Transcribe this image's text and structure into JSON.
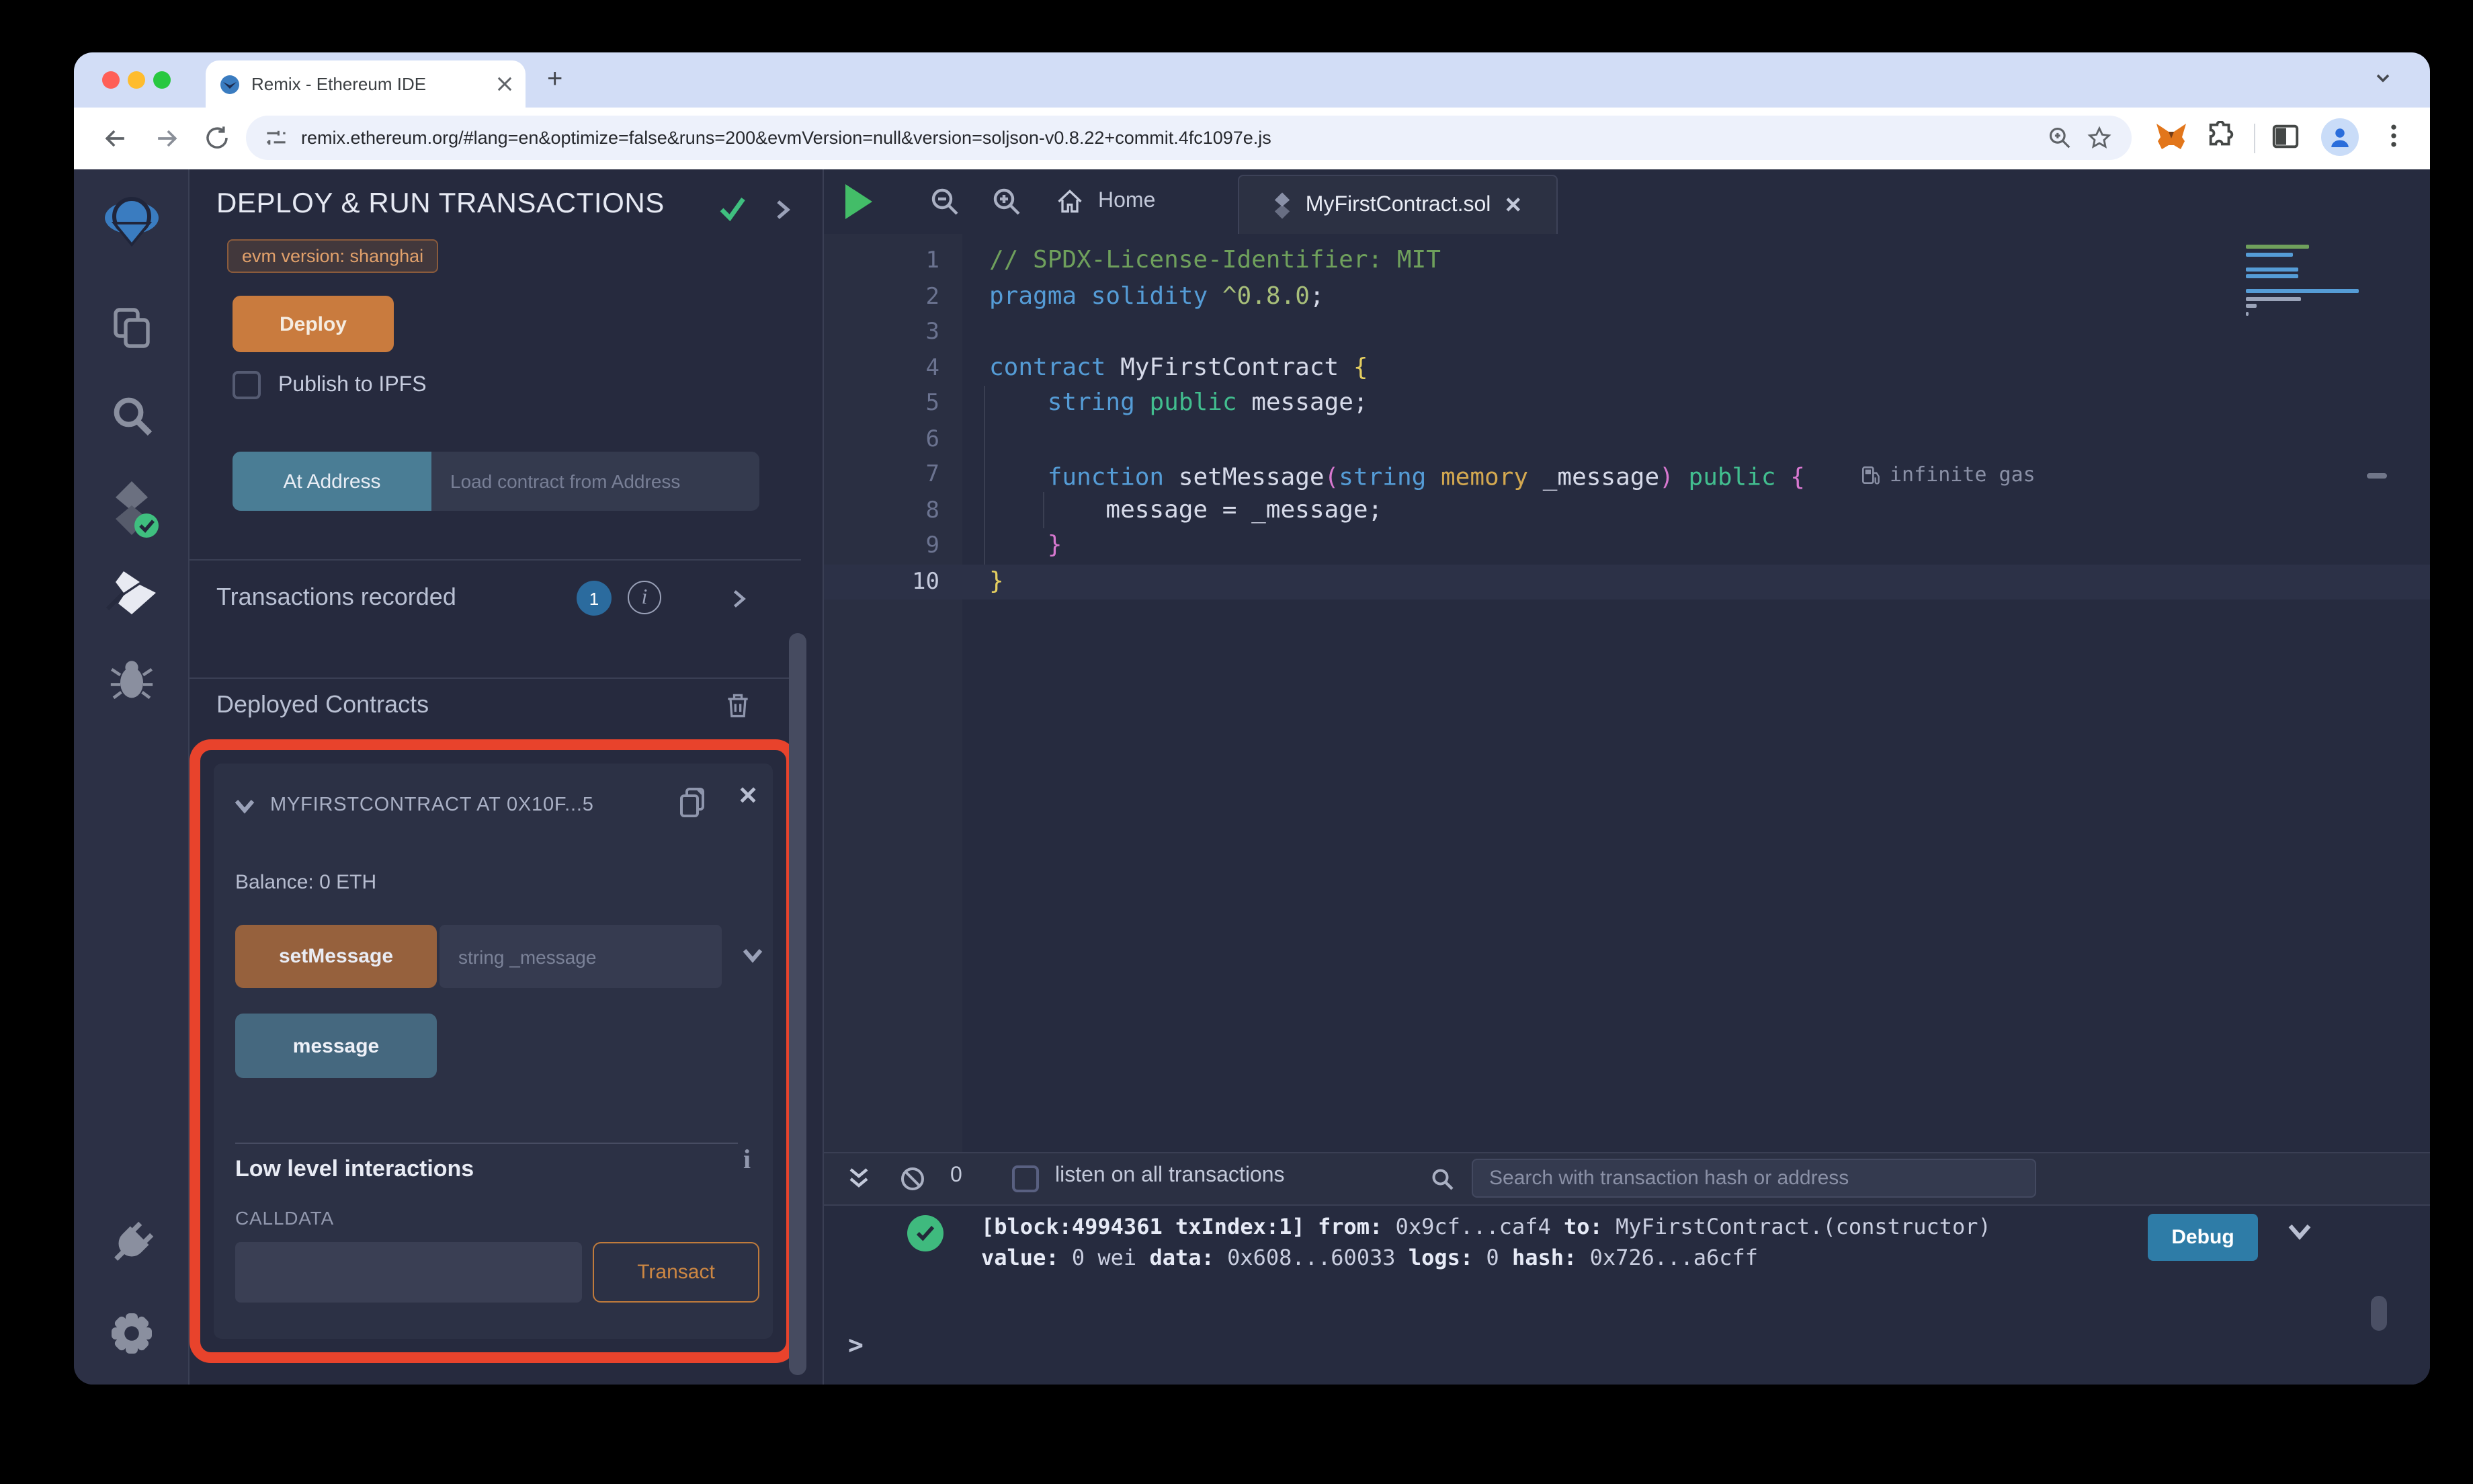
{
  "colors": {
    "highlight_red": "#E8432C",
    "deploy_orange": "#C97B3E",
    "at_address_teal": "#4A7D95",
    "set_message_brown": "#96613D",
    "message_blue": "#45687F",
    "debug_blue": "#2E7CA7",
    "success_green": "#3FBA7E",
    "badge_blue": "#2B6B9E",
    "evm_badge_text": "#E2A16B"
  },
  "browser": {
    "tab_title": "Remix - Ethereum IDE",
    "url": "remix.ethereum.org/#lang=en&optimize=false&runs=200&evmVersion=null&version=soljson-v0.8.22+commit.4fc1097e.js"
  },
  "panel": {
    "title": "DEPLOY & RUN TRANSACTIONS",
    "evm_badge": "evm version: shanghai",
    "deploy_label": "Deploy",
    "publish_label": "Publish to IPFS",
    "at_address_label": "At Address",
    "at_address_placeholder": "Load contract from Address",
    "transactions_label": "Transactions recorded",
    "transactions_count": "1",
    "deployed_title": "Deployed Contracts",
    "contract": {
      "header": "MYFIRSTCONTRACT AT 0X10F...5",
      "balance": "Balance: 0 ETH",
      "set_message_label": "setMessage",
      "set_message_placeholder": "string _message",
      "message_label": "message",
      "low_level_title": "Low level interactions",
      "calldata_label": "CALLDATA",
      "transact_label": "Transact"
    }
  },
  "editor": {
    "home_tab": "Home",
    "active_tab": "MyFirstContract.sol",
    "gas_annotation": "infinite gas",
    "code_lines": [
      {
        "n": 1,
        "segs": [
          {
            "t": "// SPDX-License-Identifier: MIT",
            "c": "comment"
          }
        ]
      },
      {
        "n": 2,
        "segs": [
          {
            "t": "pragma",
            "c": "kw"
          },
          {
            "t": " ",
            "c": ""
          },
          {
            "t": "solidity",
            "c": "kw"
          },
          {
            "t": " ",
            "c": ""
          },
          {
            "t": "^0.8.0",
            "c": "ver"
          },
          {
            "t": ";",
            "c": "plain"
          }
        ]
      },
      {
        "n": 3,
        "segs": []
      },
      {
        "n": 4,
        "segs": [
          {
            "t": "contract",
            "c": "kw"
          },
          {
            "t": " MyFirstContract ",
            "c": "plain"
          },
          {
            "t": "{",
            "c": "b-yellow"
          }
        ]
      },
      {
        "n": 5,
        "segs": [
          {
            "t": "    ",
            "c": ""
          },
          {
            "t": "string",
            "c": "kw"
          },
          {
            "t": " ",
            "c": ""
          },
          {
            "t": "public",
            "c": "green"
          },
          {
            "t": " message;",
            "c": "plain"
          }
        ]
      },
      {
        "n": 6,
        "segs": []
      },
      {
        "n": 7,
        "gas": true,
        "segs": [
          {
            "t": "    ",
            "c": ""
          },
          {
            "t": "function",
            "c": "kw"
          },
          {
            "t": " setMessage",
            "c": "plain"
          },
          {
            "t": "(",
            "c": "b-pink"
          },
          {
            "t": "string",
            "c": "kw"
          },
          {
            "t": " ",
            "c": ""
          },
          {
            "t": "memory",
            "c": "gold"
          },
          {
            "t": " _message",
            "c": "plain"
          },
          {
            "t": ")",
            "c": "b-pink"
          },
          {
            "t": " ",
            "c": ""
          },
          {
            "t": "public",
            "c": "green"
          },
          {
            "t": " ",
            "c": ""
          },
          {
            "t": "{",
            "c": "b-pink"
          }
        ]
      },
      {
        "n": 8,
        "segs": [
          {
            "t": "        message = _message;",
            "c": "plain"
          }
        ]
      },
      {
        "n": 9,
        "segs": [
          {
            "t": "    ",
            "c": ""
          },
          {
            "t": "}",
            "c": "b-pink"
          }
        ]
      },
      {
        "n": 10,
        "current": true,
        "segs": [
          {
            "t": "}",
            "c": "b-yellow"
          }
        ]
      }
    ]
  },
  "terminal": {
    "pending_count": "0",
    "listen_label": "listen on all transactions",
    "search_placeholder": "Search with transaction hash or address",
    "debug_label": "Debug",
    "prompt": ">",
    "log_line1": [
      {
        "t": "[block:4994361 txIndex:1]",
        "b": true
      },
      {
        "t": " ",
        "b": false
      },
      {
        "t": "from:",
        "b": true
      },
      {
        "t": " 0x9cf...caf4 ",
        "b": false
      },
      {
        "t": "to:",
        "b": true
      },
      {
        "t": " MyFirstContract.(constructor)",
        "b": false
      }
    ],
    "log_line2": [
      {
        "t": "value:",
        "b": true
      },
      {
        "t": " 0 wei ",
        "b": false
      },
      {
        "t": "data:",
        "b": true
      },
      {
        "t": " 0x608...60033 ",
        "b": false
      },
      {
        "t": "logs:",
        "b": true
      },
      {
        "t": " 0 ",
        "b": false
      },
      {
        "t": "hash:",
        "b": true
      },
      {
        "t": " 0x726...a6cff",
        "b": false
      }
    ]
  }
}
